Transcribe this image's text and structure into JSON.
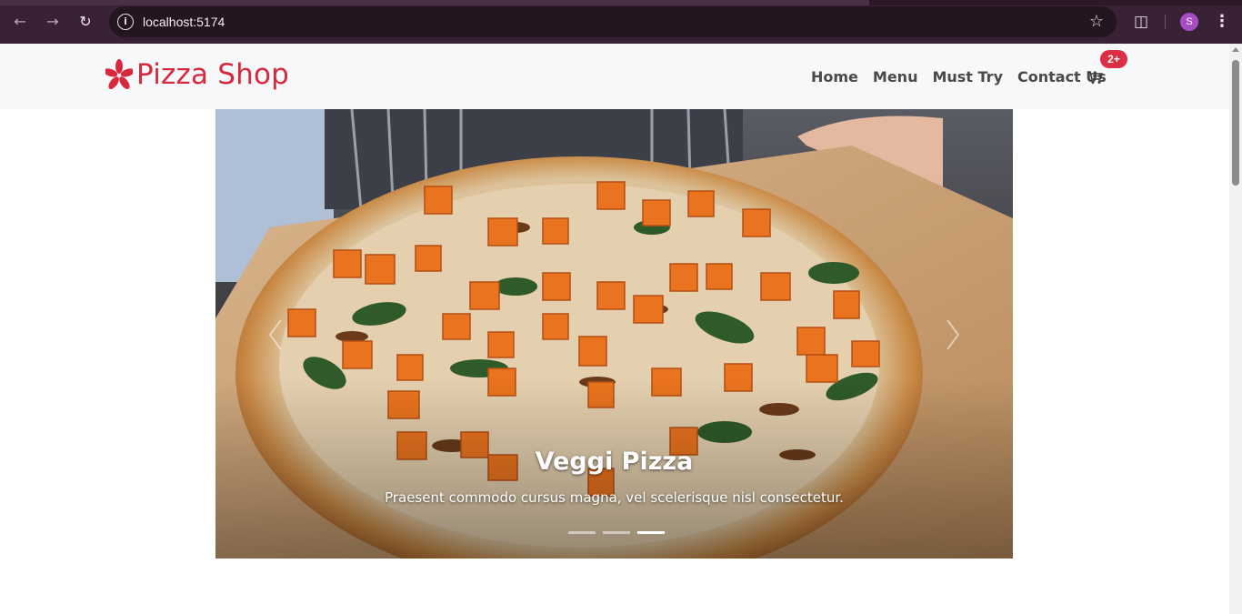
{
  "browser": {
    "url": "localhost:5174",
    "profile_initial": "S"
  },
  "navbar": {
    "brand": "Pizza Shop",
    "links": [
      "Home",
      "Menu",
      "Must Try",
      "Contact Us"
    ],
    "cart_badge": "2+"
  },
  "carousel": {
    "title": "Veggi Pizza",
    "text": "Praesent commodo cursus magna, vel scelerisque nisl consectetur.",
    "slide_count": 3,
    "active_index": 2
  },
  "colors": {
    "brand": "#d8283e",
    "badge": "#dc2e44",
    "browser_frame": "#3a2236"
  },
  "icons": [
    "back-arrow-icon",
    "forward-arrow-icon",
    "reload-icon",
    "info-icon",
    "star-icon",
    "extensions-icon",
    "kebab-menu-icon",
    "pizza-logo-icon",
    "cart-icon",
    "chevron-left-icon",
    "chevron-right-icon"
  ]
}
